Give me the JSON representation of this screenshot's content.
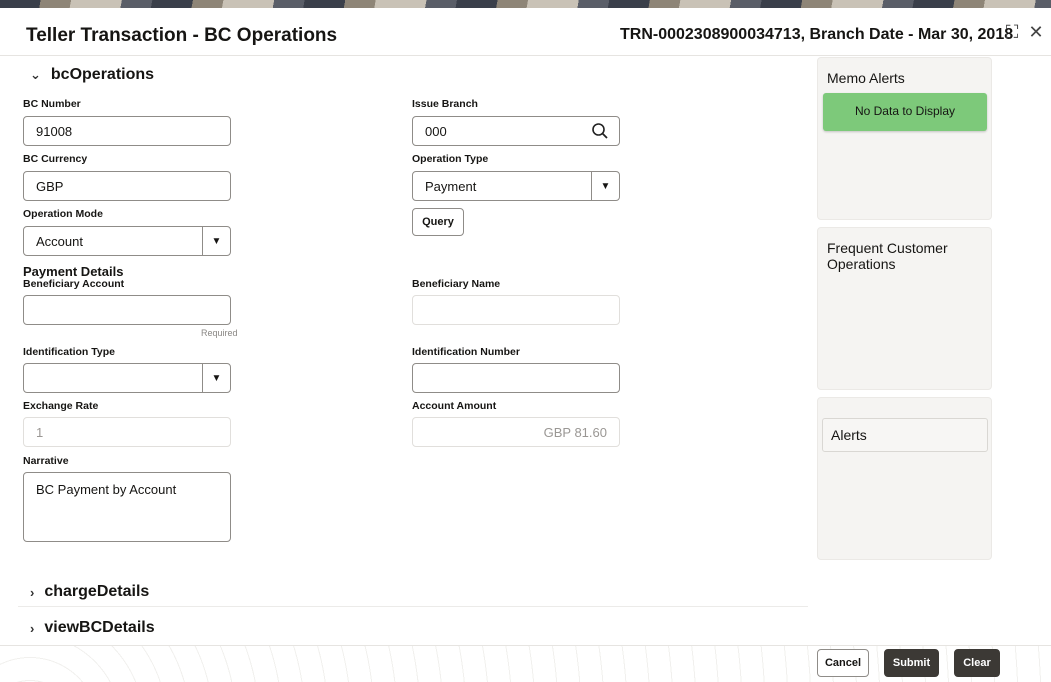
{
  "header": {
    "title": "Teller Transaction - BC Operations",
    "transaction_info": "TRN-0002308900034713, Branch Date - Mar 30, 2018",
    "maximize_icon": "maximize-icon",
    "close_icon": "close-icon",
    "maximize_glyph": "⛶",
    "close_glyph": "✕"
  },
  "sections": {
    "bcOperations": "bcOperations",
    "chargeDetails": "chargeDetails",
    "viewBCDetails": "viewBCDetails",
    "expanded_glyph": "⌄",
    "collapsed_glyph": "›"
  },
  "form": {
    "bc_number": {
      "label": "BC Number",
      "value": "91008"
    },
    "issue_branch": {
      "label": "Issue Branch",
      "value": "000"
    },
    "bc_currency": {
      "label": "BC Currency",
      "value": "GBP"
    },
    "operation_type": {
      "label": "Operation Type",
      "value": "Payment"
    },
    "operation_mode": {
      "label": "Operation Mode",
      "value": "Account"
    },
    "query_button": "Query",
    "payment_details_heading": "Payment Details",
    "beneficiary_account": {
      "label": "Beneficiary Account",
      "value": "",
      "hint": "Required"
    },
    "beneficiary_name": {
      "label": "Beneficiary Name",
      "value": ""
    },
    "identification_type": {
      "label": "Identification Type",
      "value": ""
    },
    "identification_number": {
      "label": "Identification Number",
      "value": ""
    },
    "exchange_rate": {
      "label": "Exchange Rate",
      "value": "1"
    },
    "account_amount": {
      "label": "Account Amount",
      "value": "GBP 81.60"
    },
    "narrative": {
      "label": "Narrative",
      "value": "BC Payment by Account"
    }
  },
  "side_panels": {
    "memo_alerts": {
      "title": "Memo Alerts",
      "empty_text": "No Data to Display"
    },
    "frequent_ops": {
      "title": "Frequent Customer Operations"
    },
    "alerts": {
      "title": "Alerts"
    }
  },
  "footer": {
    "cancel": "Cancel",
    "submit": "Submit",
    "clear": "Clear"
  },
  "colors": {
    "memo_green": "#7dc97a",
    "primary_dark": "#3c3935"
  }
}
